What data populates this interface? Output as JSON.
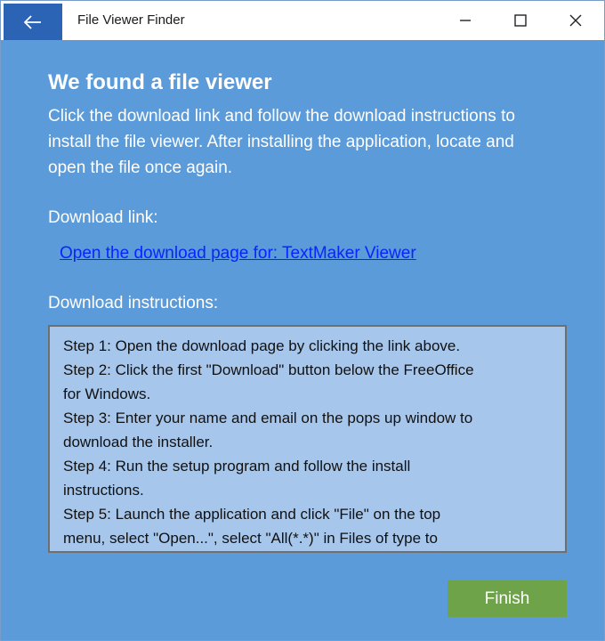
{
  "window": {
    "title": "File Viewer Finder"
  },
  "titlebar": {
    "back_icon": "arrow-left-icon",
    "minimize_icon": "minimize-icon",
    "maximize_icon": "maximize-icon",
    "close_icon": "close-icon"
  },
  "main": {
    "heading": "We found a file viewer",
    "description": "Click the download link and follow the download instructions to install the file viewer. After installing the application, locate and open the file once again.",
    "download_label": "Download link:",
    "download_link": "Open the download page for: TextMaker Viewer",
    "instructions_label": "Download instructions:",
    "instructions": [
      "Step 1: Open the download page by clicking the link above.",
      "Step 2: Click the first \"Download\" button below the FreeOffice",
      "for Windows.",
      "Step 3: Enter your name and email on the pops up window to",
      "download the installer.",
      "Step 4: Run the setup program and follow the install",
      "instructions.",
      "Step 5: Launch the application and click \"File\" on the top",
      "menu, select \"Open...\", select \"All(*.*)\" in Files of type to"
    ],
    "finish_label": "Finish"
  },
  "colors": {
    "background": "#5b9bd9",
    "back_button": "#2b63b5",
    "finish_button": "#6ea349",
    "instructions_box": "#a6c6ec",
    "link": "#0a24ff"
  }
}
